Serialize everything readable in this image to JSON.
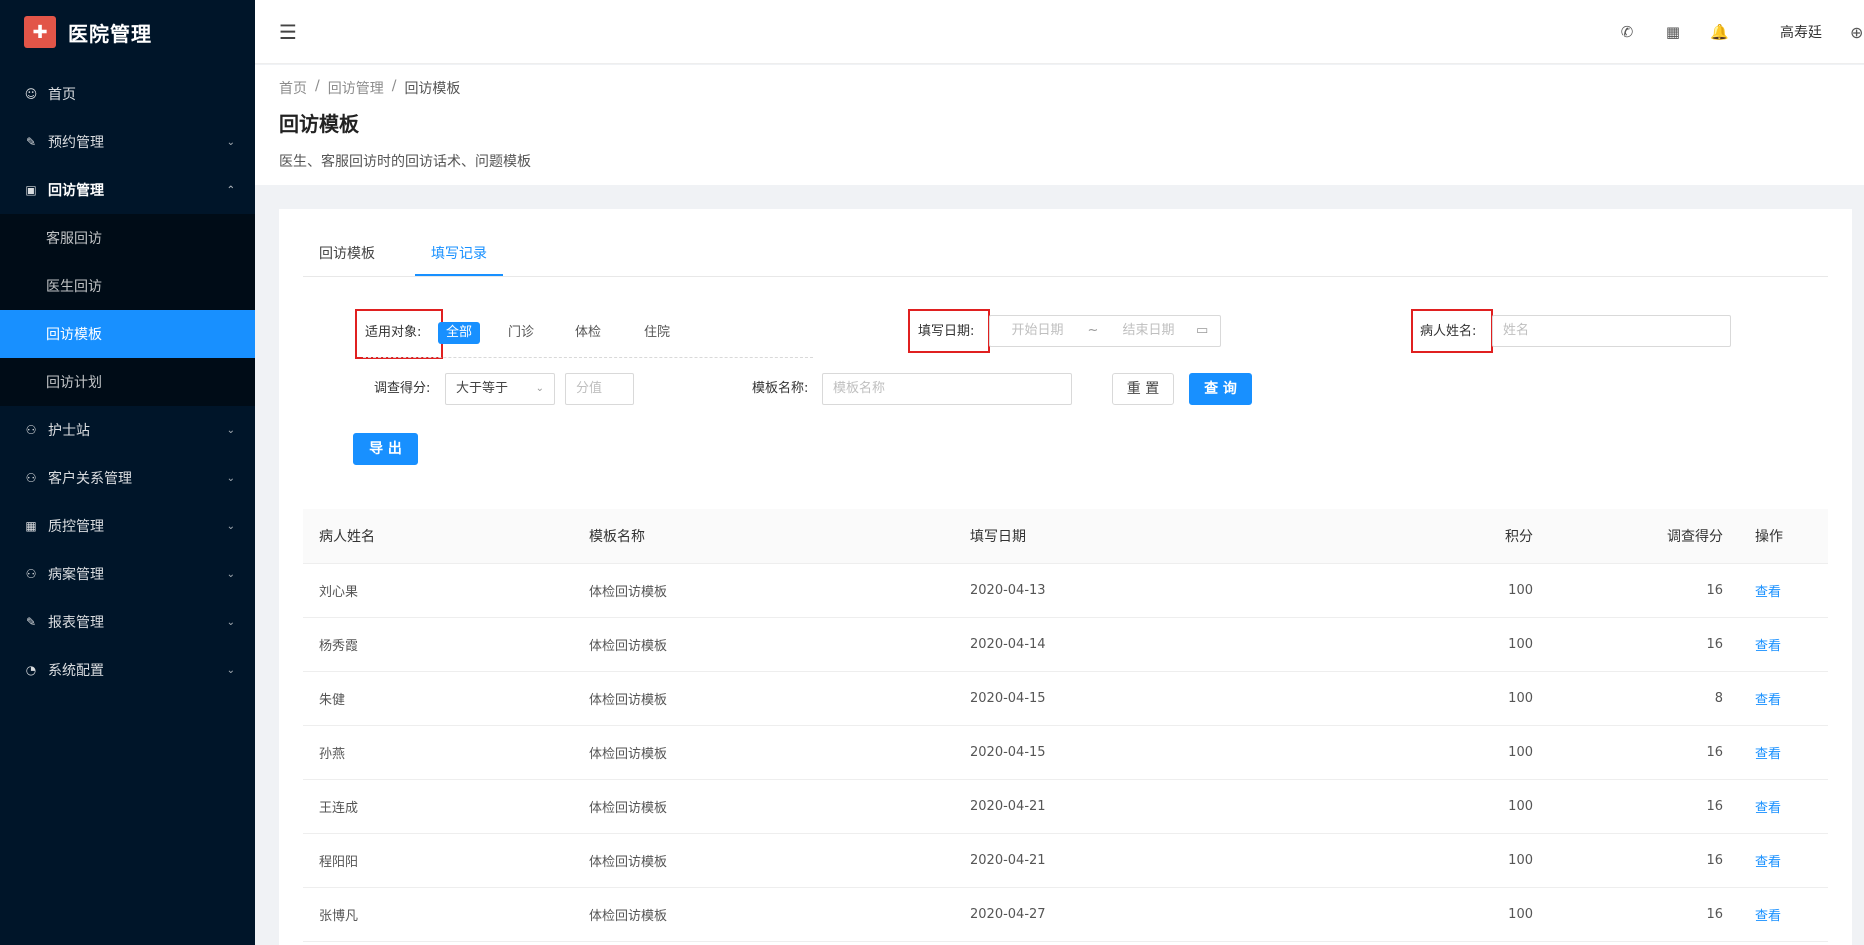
{
  "app": {
    "logo_glyph": "✚",
    "title": "医院管理"
  },
  "sidebar": {
    "items": [
      {
        "icon": "smile-icon",
        "glyph": "☺",
        "label": "首页",
        "arrow": ""
      },
      {
        "icon": "edit-icon",
        "glyph": "✎",
        "label": "预约管理",
        "arrow": "⌄"
      },
      {
        "icon": "lock-icon",
        "glyph": "▣",
        "label": "回访管理",
        "arrow": "⌃"
      },
      {
        "icon": "user-icon",
        "glyph": "⚇",
        "label": "护士站",
        "arrow": "⌄"
      },
      {
        "icon": "user-icon",
        "glyph": "⚇",
        "label": "客户关系管理",
        "arrow": "⌄"
      },
      {
        "icon": "table-icon",
        "glyph": "▦",
        "label": "质控管理",
        "arrow": "⌄"
      },
      {
        "icon": "user-icon",
        "glyph": "⚇",
        "label": "病案管理",
        "arrow": "⌄"
      },
      {
        "icon": "edit-icon",
        "glyph": "✎",
        "label": "报表管理",
        "arrow": "⌄"
      },
      {
        "icon": "dashboard-icon",
        "glyph": "◔",
        "label": "系统配置",
        "arrow": "⌄"
      }
    ],
    "submenu": [
      "客服回访",
      "医生回访",
      "回访模板",
      "回访计划"
    ]
  },
  "header": {
    "fold_glyph": "☰",
    "phone_glyph": "✆",
    "apps_glyph": "▦",
    "bell_glyph": "🔔",
    "user": "高寿廷",
    "globe_glyph": "⊕"
  },
  "breadcrumb": [
    "首页",
    "/",
    "回访管理",
    "/",
    "回访模板"
  ],
  "page": {
    "title": "回访模板",
    "description": "医生、客服回访时的回访话术、问题模板"
  },
  "tabs": [
    "回访模板",
    "填写记录"
  ],
  "filters": {
    "target_label": "适用对象:",
    "target_options": [
      "全部",
      "门诊",
      "体检",
      "住院"
    ],
    "date_label": "填写日期:",
    "date_start_placeholder": "开始日期",
    "date_separator": "~",
    "date_end_placeholder": "结束日期",
    "calendar_glyph": "▭",
    "patient_label": "病人姓名:",
    "patient_placeholder": "姓名",
    "score_label": "调查得分:",
    "score_operator": "大于等于",
    "score_placeholder": "分值",
    "template_label": "模板名称:",
    "template_placeholder": "模板名称",
    "reset": "重 置",
    "search": "查 询",
    "export": "导 出"
  },
  "table": {
    "columns": [
      "病人姓名",
      "模板名称",
      "填写日期",
      "积分",
      "调查得分",
      "操作"
    ],
    "rows": [
      [
        "刘心果",
        "体检回访模板",
        "2020-04-13",
        "100",
        "16",
        "查看"
      ],
      [
        "杨秀霞",
        "体检回访模板",
        "2020-04-14",
        "100",
        "16",
        "查看"
      ],
      [
        "朱健",
        "体检回访模板",
        "2020-04-15",
        "100",
        "8",
        "查看"
      ],
      [
        "孙燕",
        "体检回访模板",
        "2020-04-15",
        "100",
        "16",
        "查看"
      ],
      [
        "王连成",
        "体检回访模板",
        "2020-04-21",
        "100",
        "16",
        "查看"
      ],
      [
        "程阳阳",
        "体检回访模板",
        "2020-04-21",
        "100",
        "16",
        "查看"
      ],
      [
        "张博凡",
        "体检回访模板",
        "2020-04-27",
        "100",
        "16",
        "查看"
      ]
    ]
  },
  "colors": {
    "primary": "#1890ff",
    "sidebar": "#001529",
    "highlight": "#e02020"
  }
}
